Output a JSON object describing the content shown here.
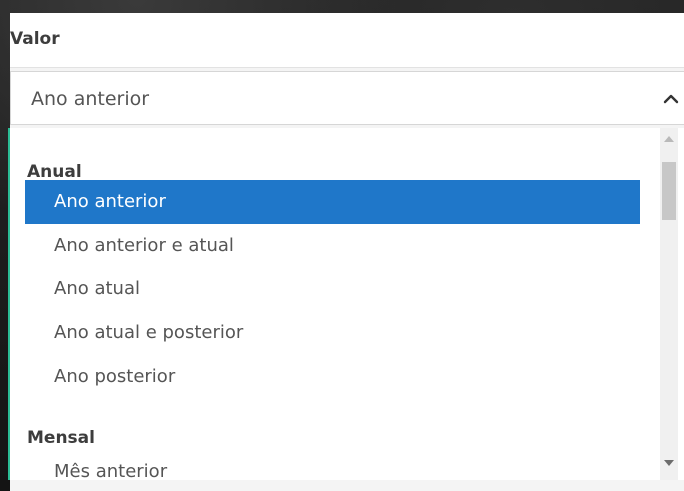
{
  "panel": {
    "title": "Valor"
  },
  "select": {
    "value": "Ano anterior",
    "chevron_icon": "chevron-up-icon"
  },
  "dropdown": {
    "accent_color": "#2bbd95",
    "selected_color": "#1f77c9",
    "groups": [
      {
        "label": "Anual",
        "options": [
          {
            "label": "Ano anterior",
            "selected": true
          },
          {
            "label": "Ano anterior e atual",
            "selected": false
          },
          {
            "label": "Ano atual",
            "selected": false
          },
          {
            "label": "Ano atual e posterior",
            "selected": false
          },
          {
            "label": "Ano posterior",
            "selected": false
          }
        ]
      },
      {
        "label": "Mensal",
        "options": [
          {
            "label": "Mês anterior",
            "selected": false
          }
        ]
      }
    ]
  }
}
